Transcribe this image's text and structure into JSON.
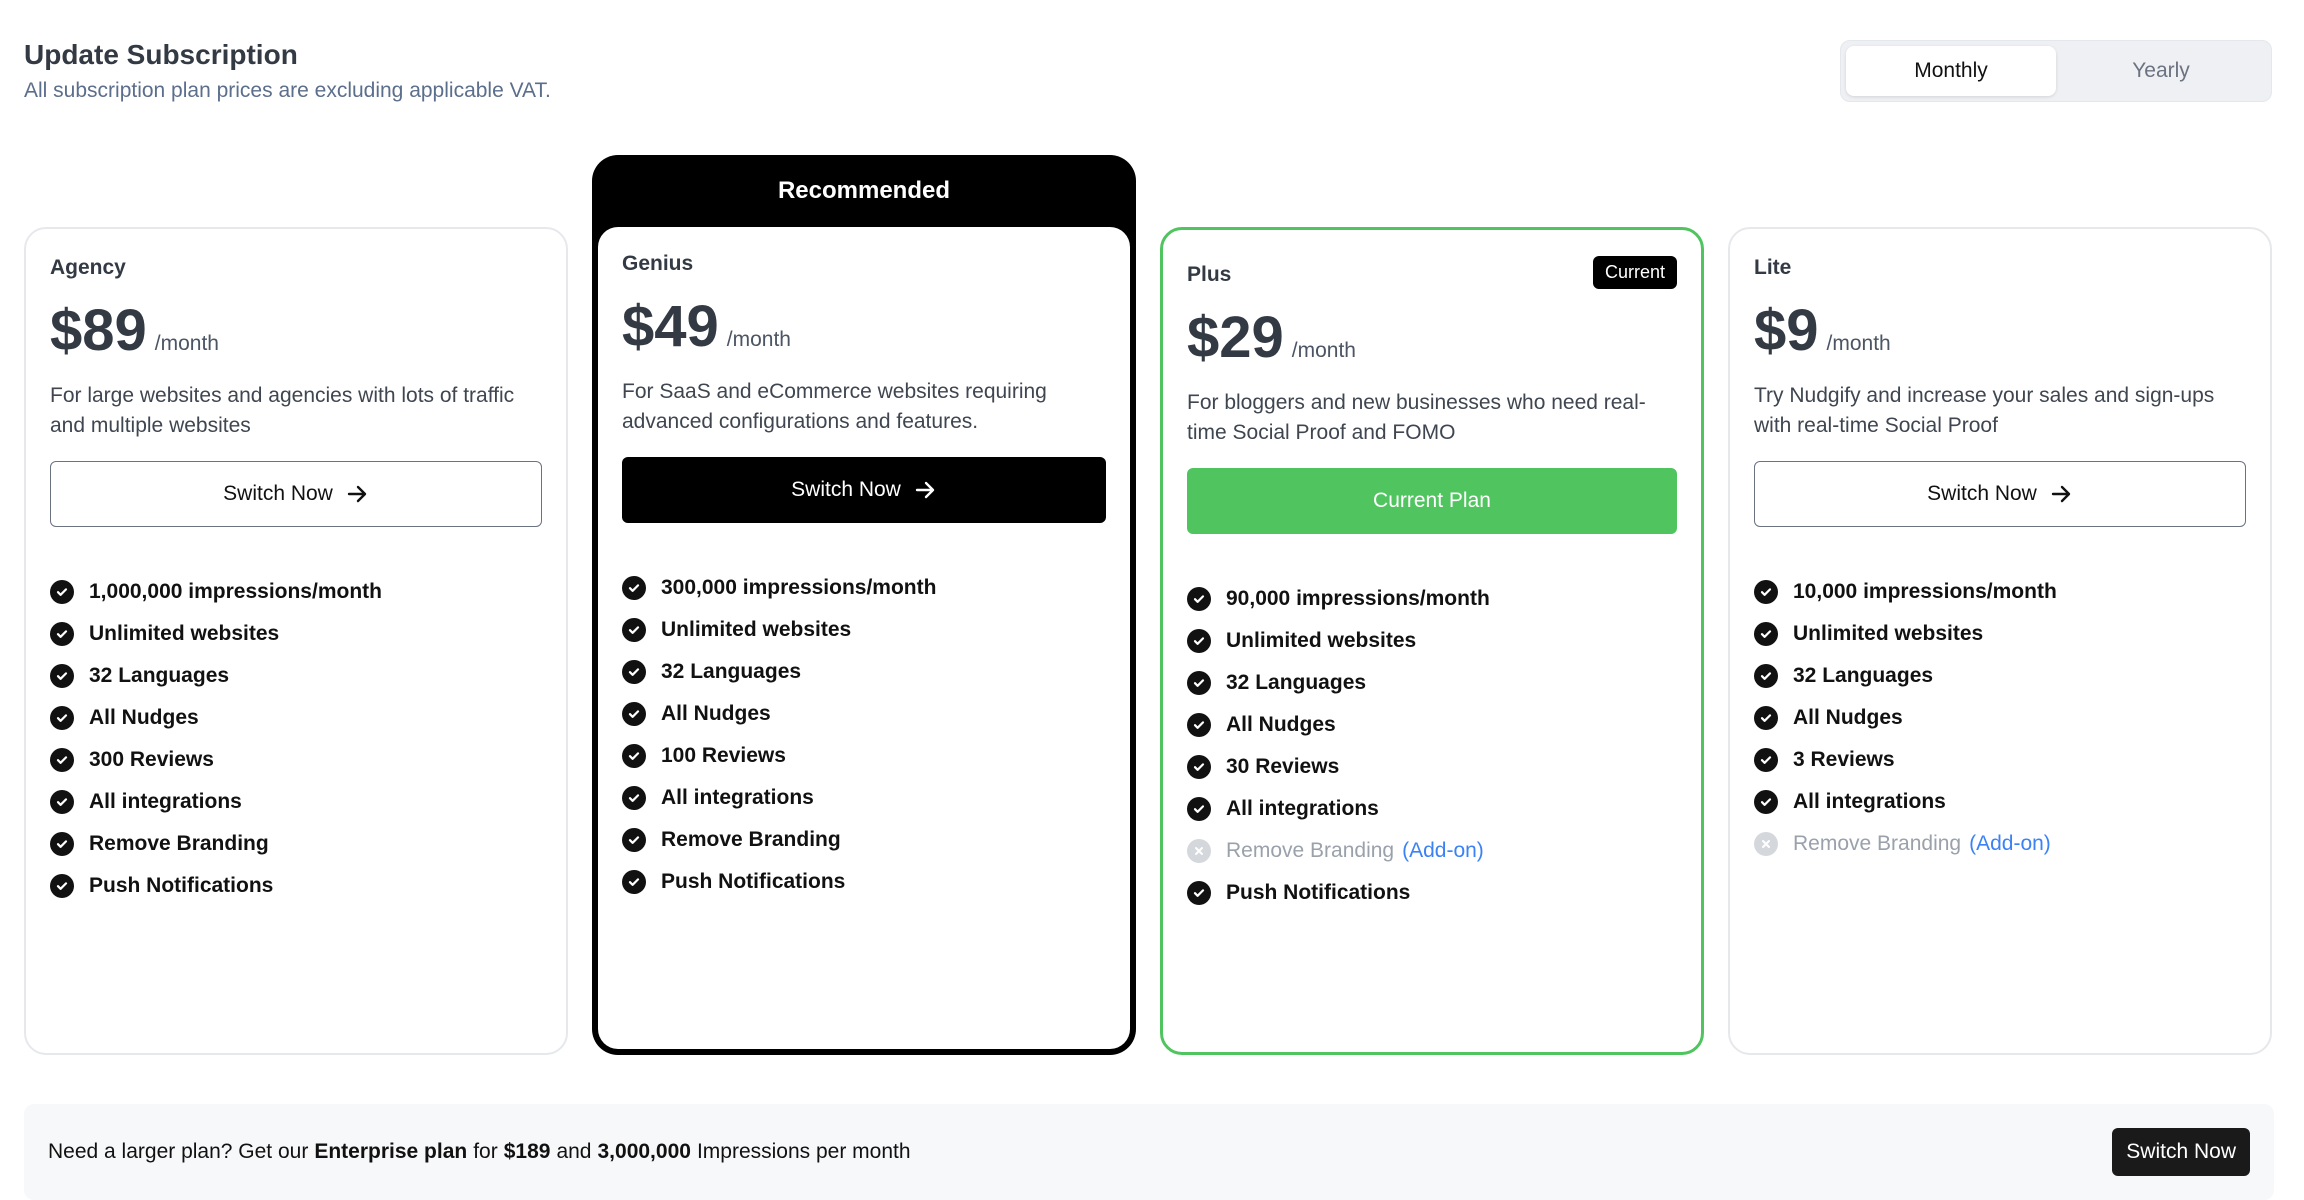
{
  "header": {
    "title": "Update Subscription",
    "subtitle": "All subscription plan prices are excluding applicable VAT."
  },
  "billing_toggle": {
    "options": [
      "Monthly",
      "Yearly"
    ],
    "selected": "Monthly"
  },
  "recommended_label": "Recommended",
  "current_badge": "Current",
  "plans": [
    {
      "name": "Agency",
      "price": "$89",
      "period": "/month",
      "description": "For large websites and agencies with lots of traffic and multiple websites",
      "button_label": "Switch Now",
      "features": [
        {
          "bold": "1,000,000",
          "text": " impressions/month"
        },
        {
          "bold": "",
          "text": "Unlimited websites"
        },
        {
          "bold": "",
          "text": "32 Languages"
        },
        {
          "bold": "",
          "text": "All Nudges"
        },
        {
          "bold": "",
          "text": "300 Reviews"
        },
        {
          "bold": "",
          "text": "All integrations"
        },
        {
          "bold": "",
          "text": "Remove Branding"
        },
        {
          "bold": "",
          "text": "Push Notifications"
        }
      ]
    },
    {
      "name": "Genius",
      "price": "$49",
      "period": "/month",
      "description": "For SaaS and eCommerce websites requiring advanced configurations and features.",
      "button_label": "Switch Now",
      "features": [
        {
          "bold": "300,000",
          "text": " impressions/month"
        },
        {
          "bold": "",
          "text": "Unlimited websites"
        },
        {
          "bold": "",
          "text": "32 Languages"
        },
        {
          "bold": "",
          "text": "All Nudges"
        },
        {
          "bold": "",
          "text": "100 Reviews"
        },
        {
          "bold": "",
          "text": "All integrations"
        },
        {
          "bold": "",
          "text": "Remove Branding"
        },
        {
          "bold": "",
          "text": "Push Notifications"
        }
      ]
    },
    {
      "name": "Plus",
      "price": "$29",
      "period": "/month",
      "description": "For bloggers and new businesses who need real-time Social Proof and FOMO",
      "button_label": "Current Plan",
      "features": [
        {
          "bold": "90,000",
          "text": " impressions/month"
        },
        {
          "bold": "",
          "text": "Unlimited websites"
        },
        {
          "bold": "",
          "text": "32 Languages"
        },
        {
          "bold": "",
          "text": "All Nudges"
        },
        {
          "bold": "",
          "text": "30 Reviews"
        },
        {
          "bold": "",
          "text": "All integrations"
        },
        {
          "bold": "",
          "text": "Remove Branding",
          "disabled": true,
          "addon": "(Add-on)"
        },
        {
          "bold": "",
          "text": "Push Notifications"
        }
      ]
    },
    {
      "name": "Lite",
      "price": "$9",
      "period": "/month",
      "description": "Try Nudgify and increase your sales and sign-ups with real-time Social Proof",
      "button_label": "Switch Now",
      "features": [
        {
          "bold": "10,000",
          "text": " impressions/month"
        },
        {
          "bold": "",
          "text": "Unlimited websites"
        },
        {
          "bold": "",
          "text": "32 Languages"
        },
        {
          "bold": "",
          "text": "All Nudges"
        },
        {
          "bold": "",
          "text": "3 Reviews"
        },
        {
          "bold": "",
          "text": "All integrations"
        },
        {
          "bold": "",
          "text": "Remove Branding",
          "disabled": true,
          "addon": "(Add-on)"
        }
      ]
    }
  ],
  "enterprise": {
    "prefix": "Need a larger plan? Get our ",
    "plan_name": "Enterprise plan",
    "mid1": " for ",
    "price": "$189",
    "mid2": " and ",
    "impressions": "3,000,000",
    "suffix": " Impressions per month",
    "button_label": "Switch Now"
  },
  "colors": {
    "accent_green": "#50c55f",
    "dark": "#000000",
    "addon_blue": "#3b82f6"
  }
}
